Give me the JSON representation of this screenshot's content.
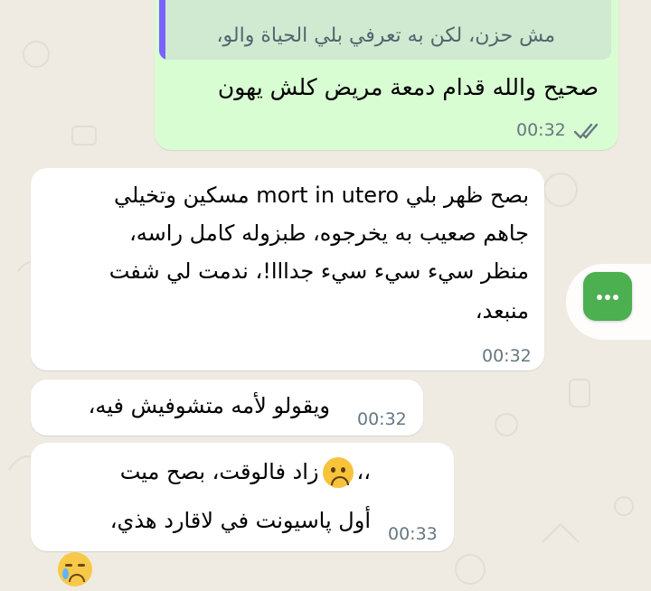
{
  "colors": {
    "outgoing_bubble": "#d9fdd3",
    "incoming_bubble": "#ffffff",
    "quote_bar": "#7b61ff",
    "fab": "#4caf50",
    "read_ticks": "#667781"
  },
  "messages": [
    {
      "direction": "outgoing",
      "quote_text": "مش حزن، لكن به تعرفي بلي الحياة والو،",
      "lines": [
        "صحيح والله قدام دمعة مريض كلش يهون"
      ],
      "time": "00:32",
      "status_icon": "double-check-icon"
    },
    {
      "direction": "incoming",
      "lines": [
        "بصح ظهر بلي mort in utero مسكين وتخيلي",
        "جاهم صعيب به يخرجوه، طبزوله كامل راسه،",
        "منظر سيء سيء سيء جدااا!، ندمت لي شفت",
        "منبعد،"
      ],
      "time": "00:32"
    },
    {
      "direction": "incoming",
      "lines": [
        "ويقولو لأمه متشوفيش فيه،"
      ],
      "time": "00:32"
    },
    {
      "direction": "incoming",
      "lines": [
        "زاد فالوقت، بصح ميت",
        "أول پاسيونت في لاقارد هذي،"
      ],
      "line1_suffix": "،،",
      "emoji": "frowning-face-emoji",
      "time": "00:33"
    }
  ],
  "reaction": {
    "emoji": "crying-face-emoji"
  },
  "fab": {
    "icon": "more-dots-icon"
  }
}
